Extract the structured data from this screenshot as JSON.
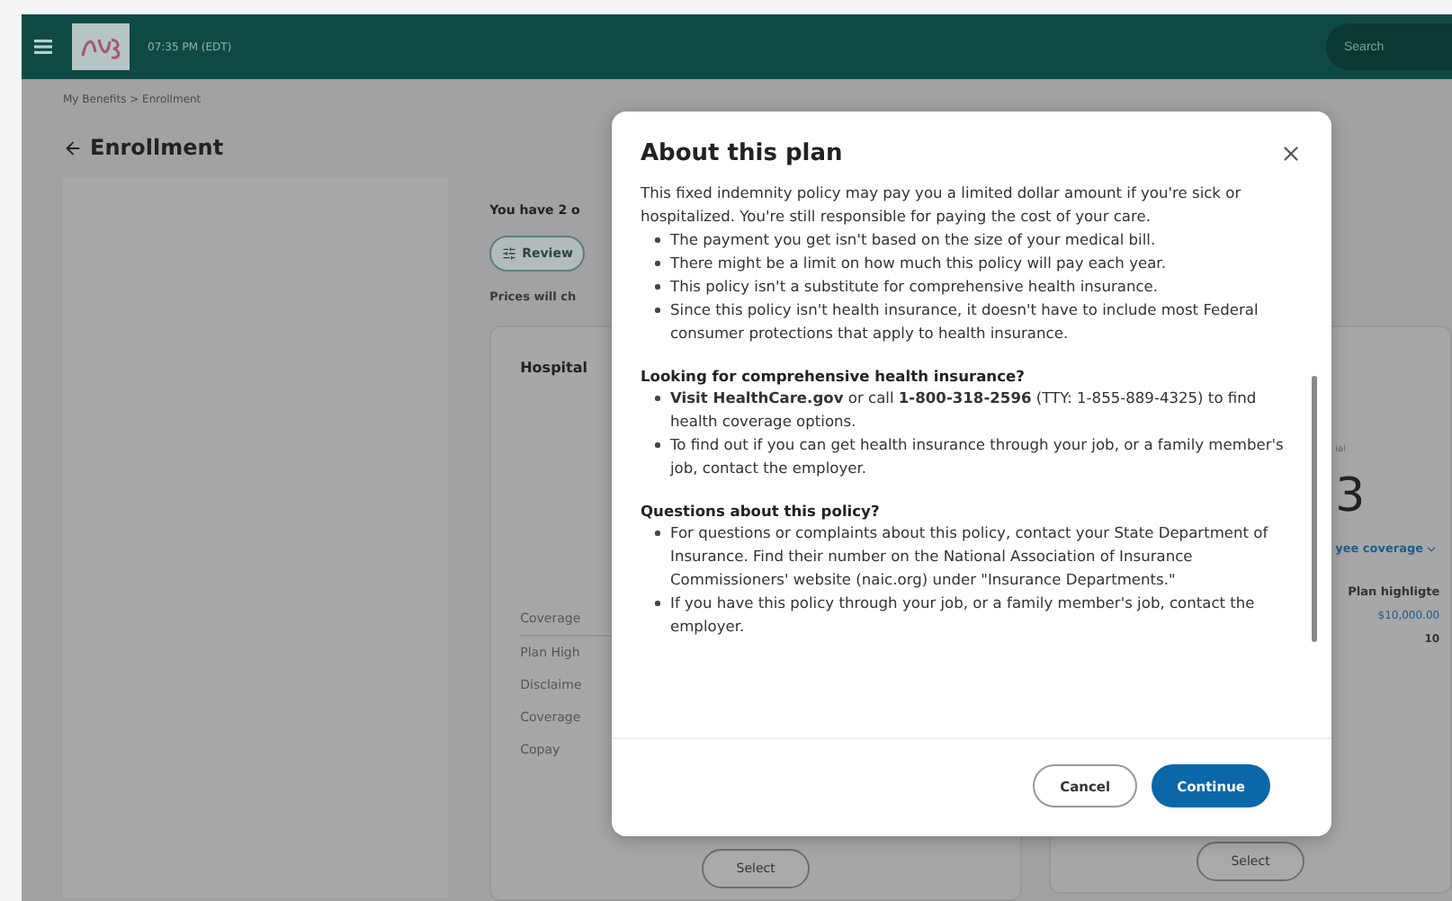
{
  "header": {
    "time": "07:35 PM (EDT)",
    "search": {
      "placeholder": "Search"
    }
  },
  "breadcrumb": "My Benefits > Enrollment",
  "page_title": "Enrollment",
  "intro": "You have 2 o",
  "review_button": "Review",
  "prices_note": "Prices will ch",
  "plan_card_left": {
    "title": "Hospital",
    "rows": [
      "Coverage",
      "Plan High",
      "Disclaime",
      "Coverage",
      "Copay"
    ],
    "select": "Select"
  },
  "plan_card_right": {
    "label": "ial",
    "amount": "3",
    "coverage_dropdown": "yee coverage",
    "rows": [
      {
        "text": "Plan highligte",
        "kind": "heading"
      },
      {
        "text": "$10,000.00",
        "kind": "link"
      },
      {
        "text": "10",
        "kind": "value"
      }
    ],
    "select": "Select"
  },
  "modal": {
    "title": "About this plan",
    "intro": "This fixed indemnity policy may pay you a limited dollar amount if you're sick or hospitalized. You're still responsible for paying the cost of your care.",
    "bullets": [
      "The payment you get isn't based on the size of your medical bill.",
      "There might be a limit on how much this policy will pay each year.",
      "This policy isn't a substitute for comprehensive health insurance.",
      "Since this policy isn't health insurance, it doesn't have to include most Federal consumer protections that apply to health insurance."
    ],
    "sections": [
      {
        "heading": "Looking for comprehensive health insurance?",
        "bullets": [
          "**Visit HealthCare.gov** or call **1-800-318-2596** (TTY: 1-855-889-4325) to find health coverage options.",
          "To find out if you can get health insurance through your job, or a family member's job, contact the employer."
        ]
      },
      {
        "heading": "Questions about this policy?",
        "bullets": [
          "For questions or complaints about this policy, contact your State Department of Insurance. Find their number on the National Association of Insurance Commissioners' website (naic.org) under \"Insurance Departments.\"",
          "If you have this policy through your job, or a family member's job, contact the employer."
        ]
      }
    ],
    "buttons": [
      {
        "label": "Cancel",
        "kind": "secondary"
      },
      {
        "label": "Continue",
        "kind": "primary"
      }
    ]
  }
}
